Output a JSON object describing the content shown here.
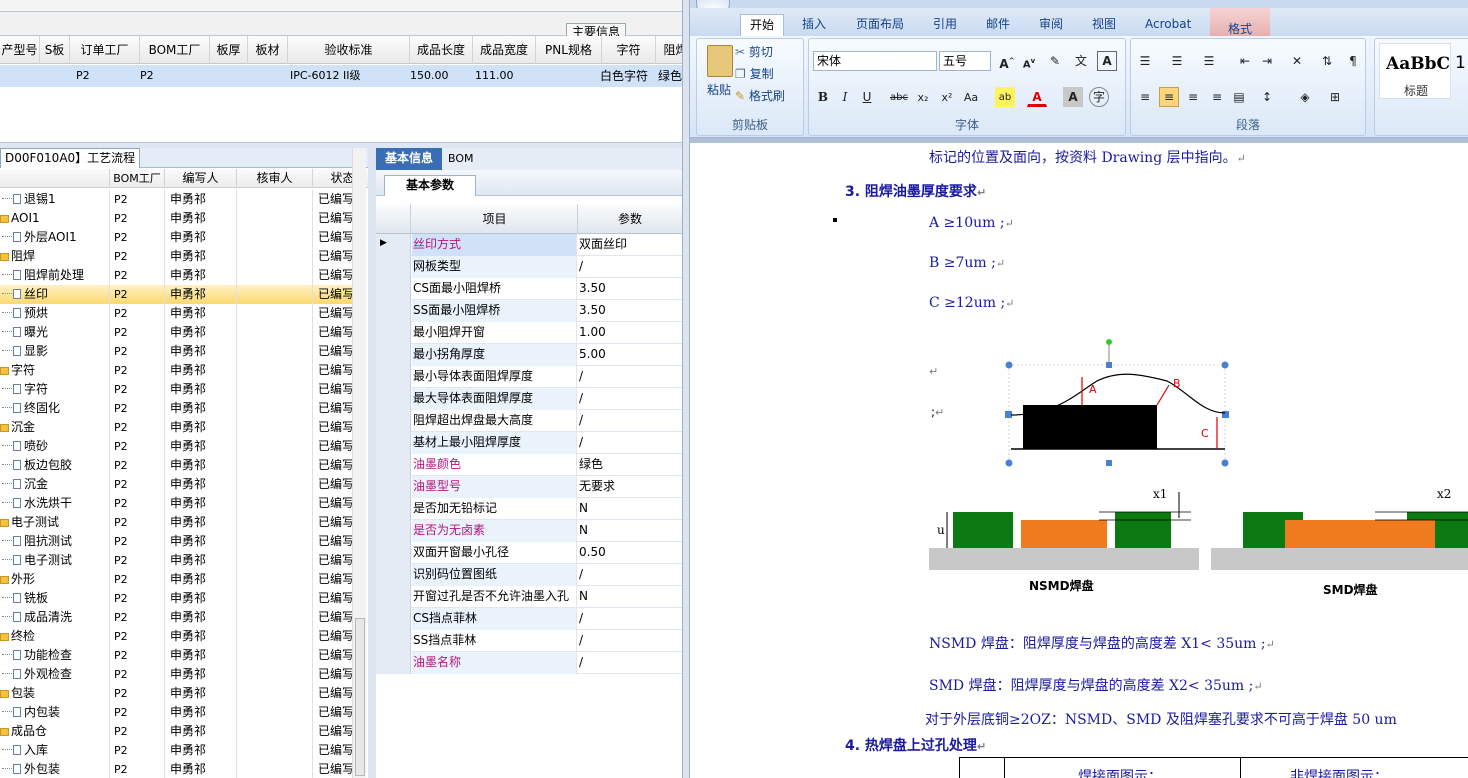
{
  "top": {
    "tab_label": "主要信息",
    "headers": [
      "产型号",
      "S板",
      "订单工厂",
      "BOM工厂",
      "板厚",
      "板材",
      "验收标准",
      "成品长度",
      "成品宽度",
      "PNL规格",
      "字符",
      "阻焊"
    ],
    "row": [
      "",
      "",
      "P2",
      "P2",
      "",
      "",
      "IPC-6012 II级",
      "150.00",
      "111.00",
      "",
      "白色字符",
      "绿色"
    ]
  },
  "tree": {
    "title_tab": "D00F010A0】工艺流程",
    "headers": [
      "",
      "BOM工厂",
      "编写人",
      "核审人",
      "状态"
    ],
    "rows": [
      {
        "name": "退锡1",
        "icon": "doc",
        "bom": "P2",
        "author": "申勇祁",
        "reviewer": "",
        "status": "已编写"
      },
      {
        "name": "AOI1",
        "icon": "folder",
        "bom": "P2",
        "author": "申勇祁",
        "reviewer": "",
        "status": "已编写"
      },
      {
        "name": "外层AOI1",
        "icon": "doc",
        "bom": "P2",
        "author": "申勇祁",
        "reviewer": "",
        "status": "已编写"
      },
      {
        "name": "阻焊",
        "icon": "folder",
        "bom": "P2",
        "author": "申勇祁",
        "reviewer": "",
        "status": "已编写"
      },
      {
        "name": "阻焊前处理",
        "icon": "doc",
        "bom": "P2",
        "author": "申勇祁",
        "reviewer": "",
        "status": "已编写"
      },
      {
        "name": "丝印",
        "icon": "doc",
        "bom": "P2",
        "author": "申勇祁",
        "reviewer": "",
        "status": "已编写"
      },
      {
        "name": "预烘",
        "icon": "doc",
        "bom": "P2",
        "author": "申勇祁",
        "reviewer": "",
        "status": "已编写"
      },
      {
        "name": "曝光",
        "icon": "doc",
        "bom": "P2",
        "author": "申勇祁",
        "reviewer": "",
        "status": "已编写"
      },
      {
        "name": "显影",
        "icon": "doc",
        "bom": "P2",
        "author": "申勇祁",
        "reviewer": "",
        "status": "已编写"
      },
      {
        "name": "字符",
        "icon": "folder",
        "bom": "P2",
        "author": "申勇祁",
        "reviewer": "",
        "status": "已编写"
      },
      {
        "name": "字符",
        "icon": "doc",
        "bom": "P2",
        "author": "申勇祁",
        "reviewer": "",
        "status": "已编写"
      },
      {
        "name": "终固化",
        "icon": "doc",
        "bom": "P2",
        "author": "申勇祁",
        "reviewer": "",
        "status": "已编写"
      },
      {
        "name": "沉金",
        "icon": "folder",
        "bom": "P2",
        "author": "申勇祁",
        "reviewer": "",
        "status": "已编写"
      },
      {
        "name": "喷砂",
        "icon": "doc",
        "bom": "P2",
        "author": "申勇祁",
        "reviewer": "",
        "status": "已编写"
      },
      {
        "name": "板边包胶",
        "icon": "doc",
        "bom": "P2",
        "author": "申勇祁",
        "reviewer": "",
        "status": "已编写"
      },
      {
        "name": "沉金",
        "icon": "doc",
        "bom": "P2",
        "author": "申勇祁",
        "reviewer": "",
        "status": "已编写"
      },
      {
        "name": "水洗烘干",
        "icon": "doc",
        "bom": "P2",
        "author": "申勇祁",
        "reviewer": "",
        "status": "已编写"
      },
      {
        "name": "电子测试",
        "icon": "folder",
        "bom": "P2",
        "author": "申勇祁",
        "reviewer": "",
        "status": "已编写"
      },
      {
        "name": "阻抗测试",
        "icon": "doc",
        "bom": "P2",
        "author": "申勇祁",
        "reviewer": "",
        "status": "已编写"
      },
      {
        "name": "电子测试",
        "icon": "doc",
        "bom": "P2",
        "author": "申勇祁",
        "reviewer": "",
        "status": "已编写"
      },
      {
        "name": "外形",
        "icon": "folder",
        "bom": "P2",
        "author": "申勇祁",
        "reviewer": "",
        "status": "已编写"
      },
      {
        "name": "铣板",
        "icon": "doc",
        "bom": "P2",
        "author": "申勇祁",
        "reviewer": "",
        "status": "已编写"
      },
      {
        "name": "成品清洗",
        "icon": "doc",
        "bom": "P2",
        "author": "申勇祁",
        "reviewer": "",
        "status": "已编写"
      },
      {
        "name": "终检",
        "icon": "folder",
        "bom": "P2",
        "author": "申勇祁",
        "reviewer": "",
        "status": "已编写"
      },
      {
        "name": "功能检查",
        "icon": "doc",
        "bom": "P2",
        "author": "申勇祁",
        "reviewer": "",
        "status": "已编写"
      },
      {
        "name": "外观检查",
        "icon": "doc",
        "bom": "P2",
        "author": "申勇祁",
        "reviewer": "",
        "status": "已编写"
      },
      {
        "name": "包装",
        "icon": "folder",
        "bom": "P2",
        "author": "申勇祁",
        "reviewer": "",
        "status": "已编写"
      },
      {
        "name": "内包装",
        "icon": "doc",
        "bom": "P2",
        "author": "申勇祁",
        "reviewer": "",
        "status": "已编写"
      },
      {
        "name": "成品仓",
        "icon": "folder",
        "bom": "P2",
        "author": "申勇祁",
        "reviewer": "",
        "status": "已编写"
      },
      {
        "name": "入库",
        "icon": "doc",
        "bom": "P2",
        "author": "申勇祁",
        "reviewer": "",
        "status": "已编写"
      },
      {
        "name": "外包装",
        "icon": "doc",
        "bom": "P2",
        "author": "申勇祁",
        "reviewer": "",
        "status": "已编写"
      }
    ]
  },
  "params": {
    "tab_basic": "基本信息",
    "tab_bom": "BOM",
    "subtab": "基本参数",
    "col_item": "项目",
    "col_value": "参数",
    "rows": [
      {
        "k": "丝印方式",
        "v": "双面丝印",
        "hl": true
      },
      {
        "k": "网板类型",
        "v": "/",
        "hl": false
      },
      {
        "k": "CS面最小阻焊桥",
        "v": "3.50",
        "hl": false
      },
      {
        "k": "SS面最小阻焊桥",
        "v": "3.50",
        "hl": false
      },
      {
        "k": "最小阻焊开窗",
        "v": "1.00",
        "hl": false
      },
      {
        "k": "最小拐角厚度",
        "v": "5.00",
        "hl": false
      },
      {
        "k": "最小导体表面阻焊厚度",
        "v": "/",
        "hl": false
      },
      {
        "k": "最大导体表面阻焊厚度",
        "v": "/",
        "hl": false
      },
      {
        "k": "阻焊超出焊盘最大高度",
        "v": "/",
        "hl": false
      },
      {
        "k": "基材上最小阻焊厚度",
        "v": "/",
        "hl": false
      },
      {
        "k": "油墨颜色",
        "v": "绿色",
        "hl": true
      },
      {
        "k": "油墨型号",
        "v": "无要求",
        "hl": true
      },
      {
        "k": "是否加无铅标记",
        "v": "N",
        "hl": false
      },
      {
        "k": "是否为无卤素",
        "v": "N",
        "hl": true
      },
      {
        "k": "双面开窗最小孔径",
        "v": "0.50",
        "hl": false
      },
      {
        "k": "识别码位置图纸",
        "v": "/",
        "hl": false
      },
      {
        "k": "开窗过孔是否不允许油墨入孔",
        "v": "N",
        "hl": false
      },
      {
        "k": "CS挡点菲林",
        "v": "/",
        "hl": false
      },
      {
        "k": "SS挡点菲林",
        "v": "/",
        "hl": false
      },
      {
        "k": "油墨名称",
        "v": "/",
        "hl": true
      }
    ]
  },
  "word": {
    "tabs": [
      "开始",
      "插入",
      "页面布局",
      "引用",
      "邮件",
      "审阅",
      "视图",
      "Acrobat",
      "格式"
    ],
    "clipboard": {
      "paste": "粘贴",
      "cut": "剪切",
      "copy": "复制",
      "format_painter": "格式刷",
      "label": "剪贴板"
    },
    "font": {
      "name": "宋体",
      "size": "五号",
      "label": "字体"
    },
    "paragraph_label": "段落",
    "style": {
      "sample": "AaBbC",
      "name": "标题",
      "next": "1"
    },
    "doc": {
      "line0": "标记的位置及面向，按资料 Drawing 层中指向。",
      "h3": "3. 阻焊油墨厚度要求",
      "a": "A ≥10um ;",
      "b": "B ≥7um ;",
      "c": "C ≥12um ;",
      "semi": ";",
      "fig_a": "A",
      "fig_b": "B",
      "fig_c": "C",
      "x1": "x1",
      "x2": "x2",
      "u": "u",
      "nsmd_label": "NSMD焊盘",
      "smd_label": "SMD焊盘",
      "nsmd_text": "NSMD 焊盘：阻焊厚度与焊盘的高度差 X1< 35um ;",
      "smd_text": "SMD 焊盘：阻焊厚度与焊盘的高度差 X2< 35um ;",
      "copper_text": "对于外层底铜≥2OZ：NSMD、SMD 及阻焊塞孔要求不可高于焊盘 50 um",
      "h4": "4. 热焊盘上过孔处理",
      "t1": "焊接面图示：",
      "t2": "非焊接面图示："
    }
  }
}
